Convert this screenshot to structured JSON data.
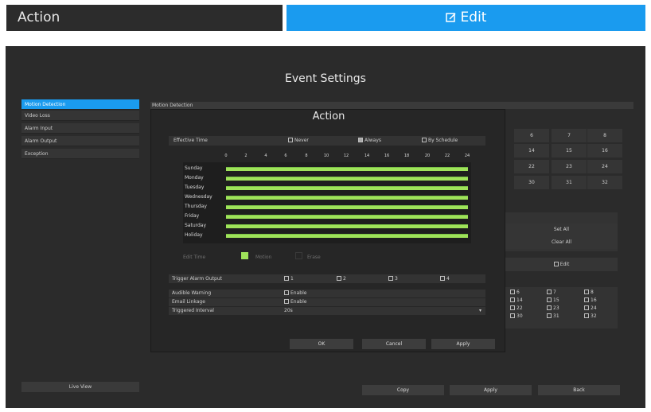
{
  "header": {
    "left_title": "Action",
    "right_title": "Edit"
  },
  "panel": {
    "title": "Event Settings"
  },
  "sidebar": {
    "items": [
      "Motion Detection",
      "Video Loss",
      "Alarm Input",
      "Alarm Output",
      "Exception"
    ],
    "live_view": "Live View"
  },
  "motion_header": "Motion Detection",
  "behind": {
    "days": [
      [
        "6",
        "7",
        "8"
      ],
      [
        "14",
        "15",
        "16"
      ],
      [
        "22",
        "23",
        "24"
      ],
      [
        "30",
        "31",
        "32"
      ]
    ],
    "set_all": "Set All",
    "clear_all": "Clear All",
    "edit": "Edit",
    "checks": [
      [
        "6",
        "7",
        "8"
      ],
      [
        "14",
        "15",
        "16"
      ],
      [
        "22",
        "23",
        "24"
      ],
      [
        "30",
        "31",
        "32"
      ]
    ]
  },
  "dialog": {
    "title": "Action",
    "effective_time": "Effective Time",
    "never": "Never",
    "always": "Always",
    "by_schedule": "By Schedule",
    "hours": [
      "0",
      "2",
      "4",
      "6",
      "8",
      "10",
      "12",
      "14",
      "16",
      "18",
      "20",
      "22",
      "24"
    ],
    "days": [
      "Sunday",
      "Monday",
      "Tuesday",
      "Wednesday",
      "Thursday",
      "Friday",
      "Saturday",
      "Holiday"
    ],
    "edit_time": "Edit Time",
    "motion": "Motion",
    "erase": "Erase",
    "trigger_alarm_output": "Trigger Alarm Output",
    "alarm_outputs": [
      "1",
      "2",
      "3",
      "4"
    ],
    "audible_warning": "Audible Warning",
    "email_linkage": "Email Linkage",
    "triggered_interval": "Triggered Interval",
    "enable": "Enable",
    "interval_value": "20s",
    "ok": "OK",
    "cancel": "Cancel",
    "apply": "Apply"
  },
  "footer": {
    "copy": "Copy",
    "apply": "Apply",
    "back": "Back"
  },
  "colors": {
    "accent": "#1a9bef",
    "schedule_bar": "#9fe35a",
    "panel_bg": "#2b2b2b"
  }
}
